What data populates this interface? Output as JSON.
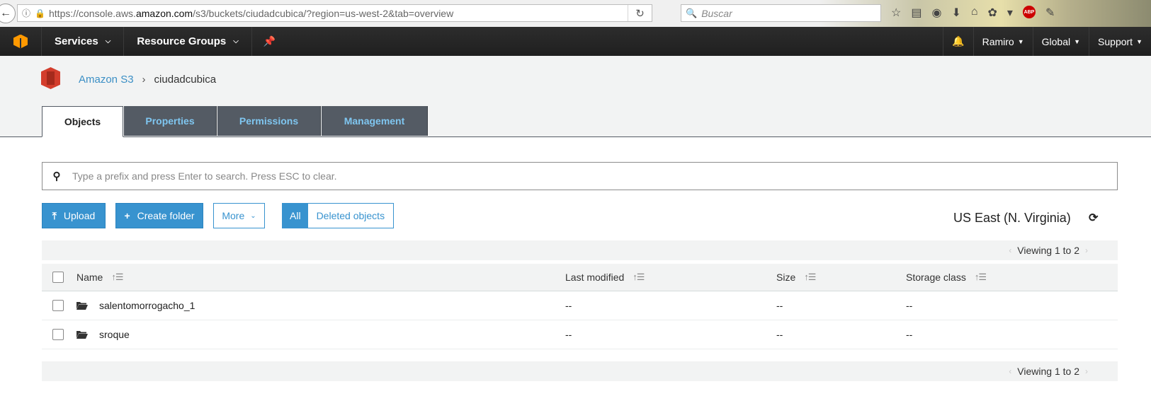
{
  "browser": {
    "url_prefix": "https://console.aws.",
    "url_domain": "amazon.com",
    "url_path": "/s3/buckets/ciudadcubica/?region=us-west-2&tab=overview",
    "search_placeholder": "Buscar",
    "abp_label": "ABP"
  },
  "nav": {
    "services": "Services",
    "resource_groups": "Resource Groups",
    "user": "Ramiro",
    "region": "Global",
    "support": "Support"
  },
  "breadcrumb": {
    "root": "Amazon S3",
    "separator": "›",
    "current": "ciudadcubica"
  },
  "tabs": [
    {
      "label": "Objects",
      "active": true
    },
    {
      "label": "Properties",
      "active": false
    },
    {
      "label": "Permissions",
      "active": false
    },
    {
      "label": "Management",
      "active": false
    }
  ],
  "search": {
    "placeholder": "Type a prefix and press Enter to search. Press ESC to clear."
  },
  "toolbar": {
    "upload": "Upload",
    "create_folder": "Create folder",
    "more": "More",
    "filter_all": "All",
    "filter_deleted": "Deleted objects"
  },
  "region_label": "US East (N. Virginia)",
  "pager": {
    "text": "Viewing 1 to 2"
  },
  "table": {
    "columns": {
      "name": "Name",
      "last_modified": "Last modified",
      "size": "Size",
      "storage_class": "Storage class"
    },
    "rows": [
      {
        "name": "salentomorrogacho_1",
        "last_modified": "--",
        "size": "--",
        "storage_class": "--"
      },
      {
        "name": "sroque",
        "last_modified": "--",
        "size": "--",
        "storage_class": "--"
      }
    ]
  },
  "colors": {
    "primary": "#3893cf",
    "nav_bg": "#232f3e",
    "tab_inactive_bg": "#545b64",
    "tab_inactive_text": "#7fc6f0",
    "aws_orange": "#ff9900"
  }
}
